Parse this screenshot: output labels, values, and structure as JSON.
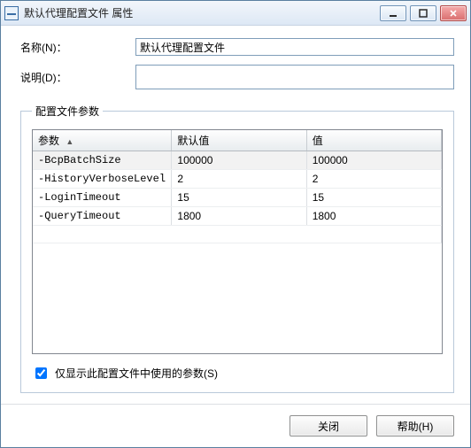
{
  "window": {
    "title": "默认代理配置文件 属性"
  },
  "form": {
    "name_label": "名称(N)：",
    "name_value": "默认代理配置文件",
    "desc_label": "说明(D)：",
    "desc_value": ""
  },
  "group": {
    "legend": "配置文件参数",
    "columns": {
      "param": "参数",
      "default": "默认值",
      "value": "值"
    },
    "sort_indicator": "▲",
    "rows": [
      {
        "param": "-BcpBatchSize",
        "default": "100000",
        "value": "100000",
        "selected": true
      },
      {
        "param": "-HistoryVerboseLevel",
        "default": "2",
        "value": "2",
        "selected": false
      },
      {
        "param": "-LoginTimeout",
        "default": "15",
        "value": "15",
        "selected": false
      },
      {
        "param": "-QueryTimeout",
        "default": "1800",
        "value": "1800",
        "selected": false
      }
    ],
    "checkbox_label": "仅显示此配置文件中使用的参数(S)",
    "checkbox_checked": true
  },
  "footer": {
    "close": "关闭",
    "help": "帮助(H)"
  }
}
